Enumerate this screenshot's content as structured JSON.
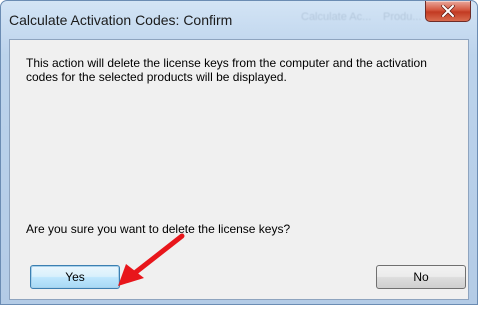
{
  "window": {
    "title": "Calculate Activation Codes: Confirm",
    "ghost_titles": [
      "Calculate Ac...",
      "Produ..."
    ]
  },
  "dialog": {
    "message": "This action will delete the license keys from the computer and the activation codes for the selected products will be displayed.",
    "question": "Are you sure you want to delete the license keys?",
    "yes_label": "Yes",
    "no_label": "No"
  },
  "annotation": {
    "arrow_color": "#e8161b",
    "points_to": "yes-button"
  },
  "icons": {
    "close": "close-icon",
    "arrow": "arrow-icon"
  }
}
